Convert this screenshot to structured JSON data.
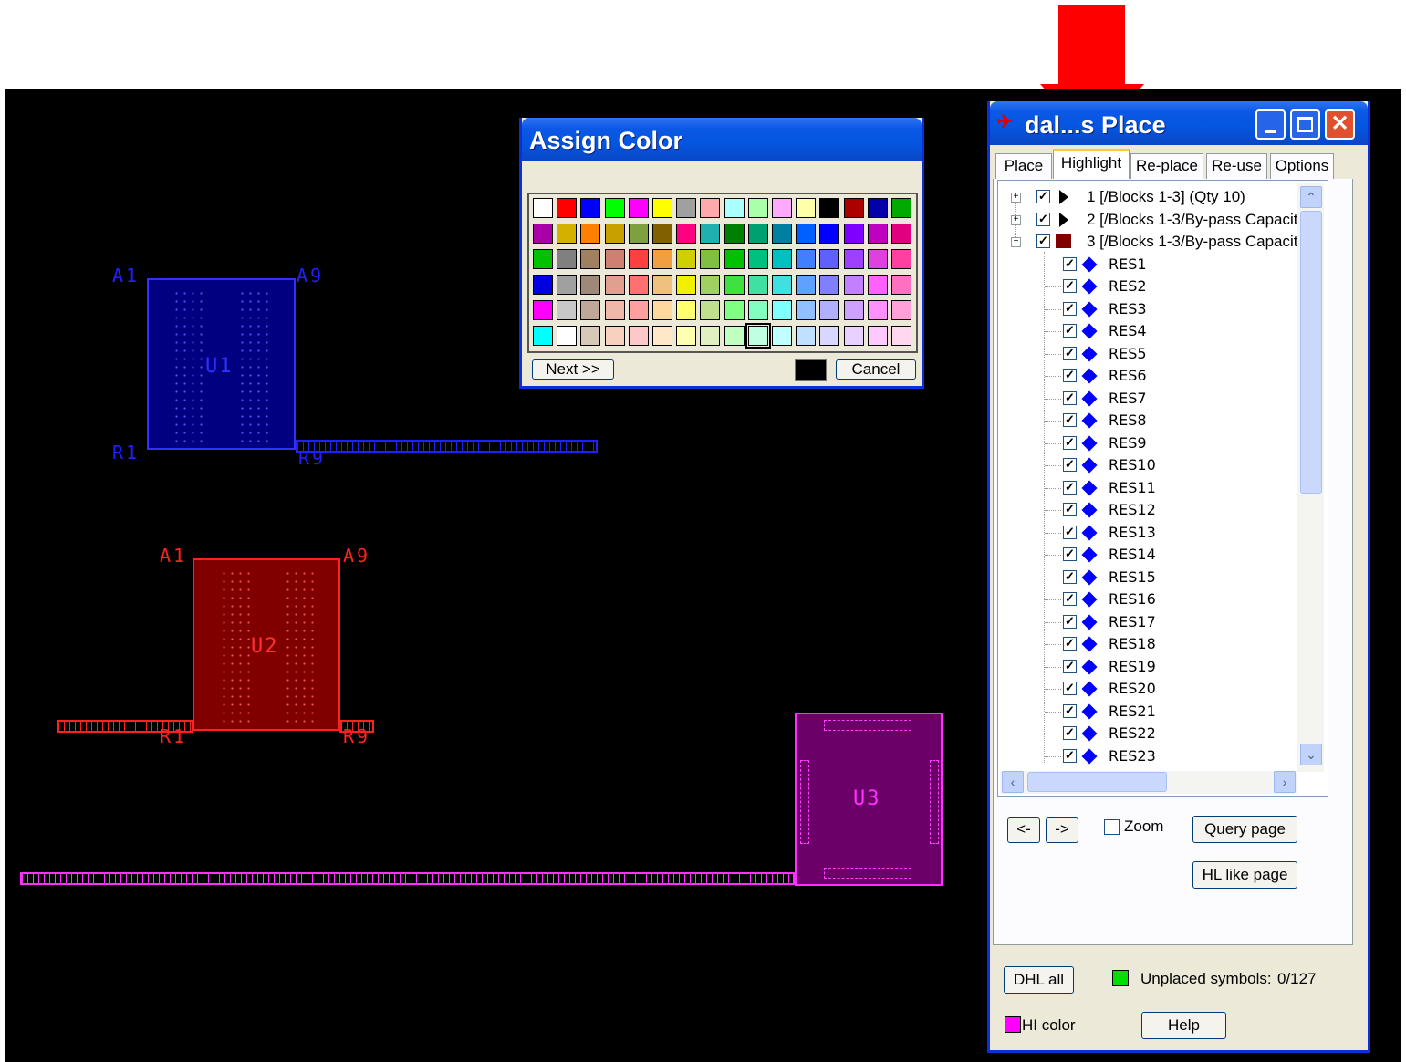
{
  "canvas": {
    "u1": {
      "label": "U1",
      "a1": "A1",
      "a9": "A9",
      "r1": "R1",
      "r9": "R9",
      "color": "#0000ff"
    },
    "u2": {
      "label": "U2",
      "a1": "A1",
      "a9": "A9",
      "r1": "R1",
      "r9": "R9",
      "color": "#ff0000"
    },
    "u3": {
      "label": "U3",
      "color": "#ff00ff"
    }
  },
  "assign_color": {
    "title": "Assign Color",
    "next_label": "Next >>",
    "cancel_label": "Cancel",
    "current_color": "#000000",
    "selected": {
      "row": 5,
      "col": 9
    },
    "rows": [
      [
        "#ffffff",
        "#ff0000",
        "#0000ff",
        "#00ff00",
        "#ff00ff",
        "#ffff00",
        "#a0a0a0",
        "#ffaaaa",
        "#aaffff",
        "#aaffaa",
        "#ffaaff",
        "#ffffaa",
        "#000000",
        "#aa0000",
        "#0000aa",
        "#00aa00"
      ],
      [
        "#aa00aa",
        "#d4b000",
        "#ff8000",
        "#c8a000",
        "#80a040",
        "#806000",
        "#ff0080",
        "#20b0b0",
        "#008000",
        "#00a070",
        "#0080a0",
        "#0060ff",
        "#0000ff",
        "#8000ff",
        "#c000c0",
        "#e00080"
      ],
      [
        "#00c000",
        "#808080",
        "#a08060",
        "#d08070",
        "#ff4040",
        "#f0a040",
        "#d0d000",
        "#80c040",
        "#00c000",
        "#00c080",
        "#00c0c0",
        "#4080ff",
        "#6060ff",
        "#a040ff",
        "#e040e0",
        "#ff40a0"
      ],
      [
        "#0000e0",
        "#a0a0a0",
        "#a08878",
        "#e0a090",
        "#ff7070",
        "#f0c080",
        "#f0f000",
        "#a0d060",
        "#40e040",
        "#40e0a0",
        "#40e0e0",
        "#60a0ff",
        "#8080ff",
        "#c080ff",
        "#ff60ff",
        "#ff70c0"
      ],
      [
        "#ff00ff",
        "#c8c8c8",
        "#c0a898",
        "#f0b8a8",
        "#ffa0a0",
        "#ffd8a0",
        "#ffff70",
        "#c0e090",
        "#80ff80",
        "#80ffc0",
        "#80ffff",
        "#90c0ff",
        "#b0b0ff",
        "#d0a0ff",
        "#ff90ff",
        "#ffa0d8"
      ],
      [
        "#00ffff",
        "#ffffff",
        "#d8c8b8",
        "#f8d0c0",
        "#ffc8c8",
        "#ffe8c8",
        "#ffffb0",
        "#e0f0c0",
        "#c0ffc0",
        "#c0ffe0",
        "#c0ffff",
        "#c0e0ff",
        "#d8d8ff",
        "#e8d0ff",
        "#ffc8ff",
        "#ffd8f0"
      ]
    ]
  },
  "place_window": {
    "title": "dal...s Place",
    "tabs": [
      "Place",
      "Highlight",
      "Re-place",
      "Re-use",
      "Options"
    ],
    "active_tab": "Highlight",
    "groups": [
      {
        "label": "1 [/Blocks 1-3] (Qty 10)",
        "marker": "triangle"
      },
      {
        "label": "2 [/Blocks 1-3/By-pass Capacito",
        "marker": "triangle"
      },
      {
        "label": "3 [/Blocks 1-3/By-pass Capacito",
        "marker": "square",
        "marker_color": "#800000"
      }
    ],
    "items": [
      "RES1",
      "RES2",
      "RES3",
      "RES4",
      "RES5",
      "RES6",
      "RES7",
      "RES8",
      "RES9",
      "RES10",
      "RES11",
      "RES12",
      "RES13",
      "RES14",
      "RES15",
      "RES16",
      "RES17",
      "RES18",
      "RES19",
      "RES20",
      "RES21",
      "RES22",
      "RES23"
    ],
    "prev_label": "<-",
    "next_label": "->",
    "zoom_label": "Zoom",
    "query_page_label": "Query page",
    "hl_like_page_label": "HL like page",
    "dhl_all_label": "DHL all",
    "unplaced_label": "Unplaced symbols:",
    "unplaced_value": "0/127",
    "unplaced_color": "#00dd00",
    "hl_color_label": "HI color",
    "hl_color": "#ff00ff",
    "help_label": "Help"
  }
}
